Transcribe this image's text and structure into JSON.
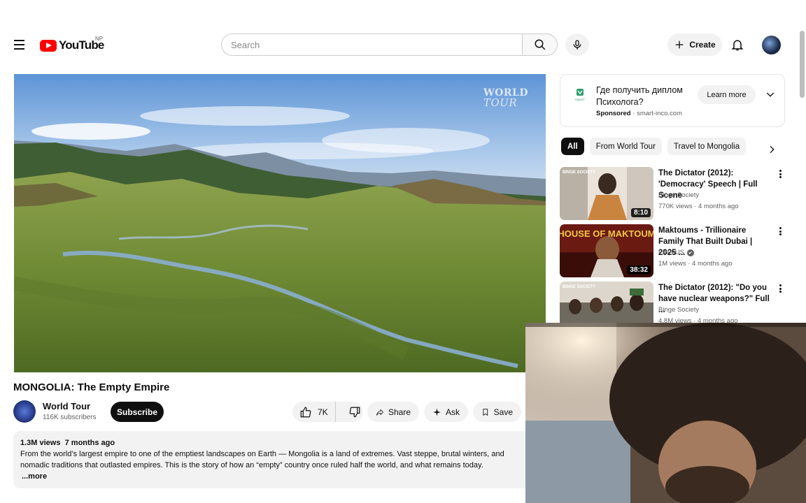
{
  "header": {
    "logo_text": "YouTube",
    "region": "NP",
    "search_placeholder": "Search",
    "create_label": "Create"
  },
  "video": {
    "watermark_line1": "WORLD",
    "watermark_line2": "TOUR",
    "title": "MONGOLIA: The Empty Empire",
    "channel": "World Tour",
    "subscribers": "116K subscribers",
    "subscribe_label": "Subscribe",
    "likes": "7K",
    "share_label": "Share",
    "ask_label": "Ask",
    "save_label": "Save",
    "views": "1.3M views",
    "age": "7 months ago",
    "description": "From the world’s largest empire to one of the emptiest landscapes on Earth — Mongolia is a land of extremes. Vast steppe, brutal winters, and nomadic traditions that outlasted empires. This is the story of how an “empty” country once ruled half the world, and what remains today.",
    "more_label": "...more"
  },
  "ad": {
    "title": "Где получить диплом Психолога?",
    "sponsored": "Sponsored",
    "domain": "smart-inco.com",
    "learn_more": "Learn more",
    "logo_caption": "SMART"
  },
  "chips": [
    "All",
    "From World Tour",
    "Travel to Mongolia"
  ],
  "recommendations": [
    {
      "title": "The Dictator (2012): 'Democracy' Speech | Full Scene",
      "channel": "Binge Society",
      "stats": "770K views · 4 months ago",
      "duration": "8:10",
      "verified": false,
      "thumb_text": "BINGE SOCIETY"
    },
    {
      "title": "Maktoums - Trillionaire Family That Built Dubai | 2025 ...",
      "channel": "FINAiUS",
      "stats": "1M views · 4 months ago",
      "duration": "38:32",
      "verified": true,
      "thumb_text": "HOUSE OF MAKTOUM"
    },
    {
      "title": "The Dictator (2012): \"Do you have nuclear weapons?\" Full ...",
      "channel": "Binge Society",
      "stats": "4.8M views · 4 months ago",
      "duration": "",
      "verified": false,
      "thumb_text": "BINGE SOCIETY"
    }
  ],
  "icons": {
    "menu": "hamburger-icon",
    "search": "search-icon",
    "mic": "mic-icon",
    "create": "plus-icon",
    "notifications": "bell-icon",
    "like": "thumbs-up-icon",
    "dislike": "thumbs-down-icon",
    "share": "share-arrow-icon",
    "ask": "sparkle-icon",
    "save": "bookmark-icon",
    "more": "vertical-dots-icon"
  }
}
